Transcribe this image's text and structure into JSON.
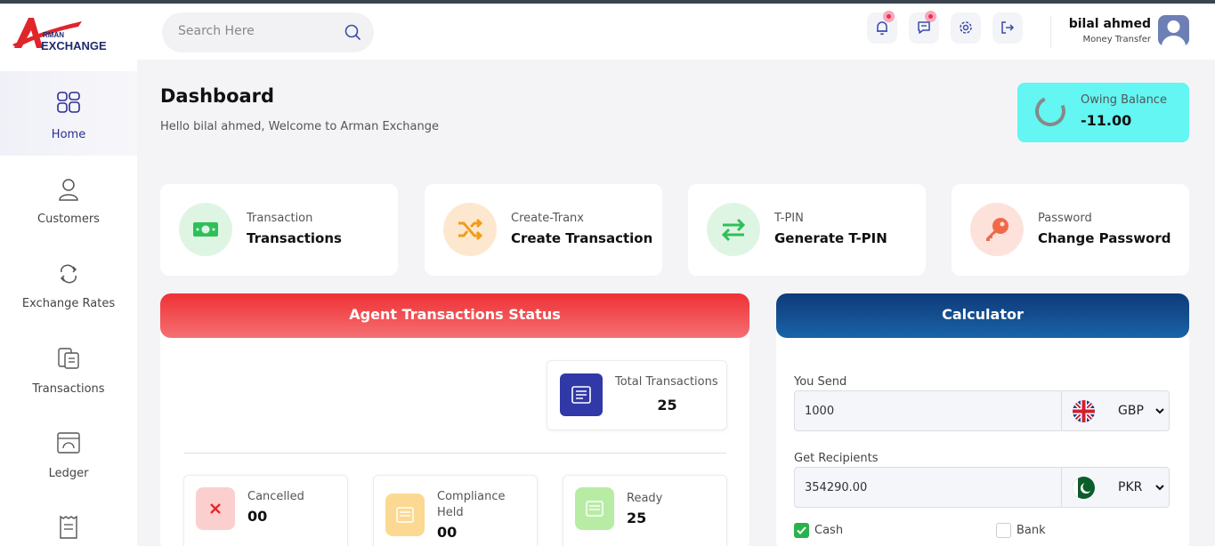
{
  "brand": {
    "logo_top": "RMAN",
    "logo_bottom": "EXCHANGE",
    "logo_letter": "A"
  },
  "search": {
    "placeholder": "Search Here"
  },
  "header": {
    "icons": [
      "bell-icon",
      "chat-icon",
      "gear-icon",
      "logout-icon"
    ]
  },
  "user": {
    "name": "bilal ahmed",
    "role": "Money Transfer"
  },
  "sidebar": {
    "items": [
      {
        "label": "Home",
        "icon": "home-grid-icon",
        "active": true
      },
      {
        "label": "Customers",
        "icon": "user-icon"
      },
      {
        "label": "Exchange Rates",
        "icon": "exchange-icon"
      },
      {
        "label": "Transactions",
        "icon": "wallet-icon"
      },
      {
        "label": "Ledger",
        "icon": "ledger-icon"
      },
      {
        "label": "",
        "icon": "receipt-icon"
      }
    ]
  },
  "page": {
    "title": "Dashboard",
    "welcome": "Hello bilal ahmed, Welcome to Arman Exchange"
  },
  "owing": {
    "label": "Owing Balance",
    "value": "-11.00"
  },
  "cards": [
    {
      "small": "Transaction",
      "big": "Transactions",
      "color": "#dff5e4"
    },
    {
      "small": "Create-Tranx",
      "big": "Create Transaction",
      "color": "#fde8cf"
    },
    {
      "small": "T-PIN",
      "big": "Generate T-PIN",
      "color": "#dff5e4"
    },
    {
      "small": "Password",
      "big": "Change Password",
      "color": "#fde2dc"
    }
  ],
  "agent": {
    "title": "Agent Transactions Status",
    "total_label": "Total Transactions",
    "total_value": "25",
    "statuses": [
      {
        "label": "Cancelled",
        "value": "00",
        "color": "#fccfcf"
      },
      {
        "label": "Compliance Held",
        "value": "00",
        "color": "#fbd992"
      },
      {
        "label": "Ready",
        "value": "25",
        "color": "#b8eca5"
      }
    ]
  },
  "calculator": {
    "title": "Calculator",
    "send_label": "You Send",
    "send_value": "1000",
    "send_currency": "GBP",
    "recv_label": "Get Recipients",
    "recv_value": "354290.00",
    "recv_currency": "PKR",
    "options": [
      {
        "label": "Cash",
        "checked": true
      },
      {
        "label": "Bank",
        "checked": false
      }
    ]
  }
}
